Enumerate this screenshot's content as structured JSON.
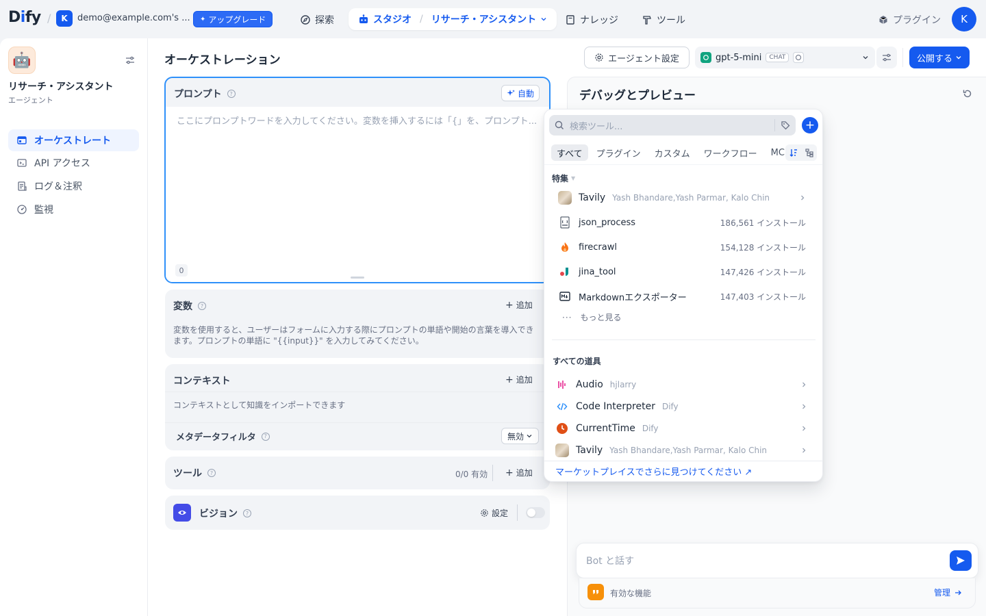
{
  "topbar": {
    "logo": "Dify",
    "workspace_initial": "K",
    "workspace_name": "demo@example.com's ...",
    "upgrade_label": "アップグレード",
    "nav": {
      "explore": "探索",
      "studio": "スタジオ",
      "app": "リサーチ・アシスタント",
      "knowledge": "ナレッジ",
      "tools": "ツール"
    },
    "plugins_label": "プラグイン",
    "user_initial": "K"
  },
  "sidebar": {
    "app_name": "リサーチ・アシスタント",
    "app_type": "エージェント",
    "items": [
      {
        "label": "オーケストレート",
        "icon": "layout-icon",
        "active": true
      },
      {
        "label": "API アクセス",
        "icon": "terminal-icon",
        "active": false
      },
      {
        "label": "ログ＆注釈",
        "icon": "file-list-icon",
        "active": false
      },
      {
        "label": "監視",
        "icon": "dashboard-gauge-icon",
        "active": false
      }
    ]
  },
  "header": {
    "title": "オーケストレーション",
    "agent_settings_label": "エージェント設定",
    "model_name": "gpt-5-mini",
    "model_badge": "CHAT",
    "publish_label": "公開する"
  },
  "prompt": {
    "title": "プロンプト",
    "auto_label": "自動",
    "placeholder": "ここにプロンプトワードを入力してください。変数を挿入するには「{」を、プロンプト...",
    "char_count": "0"
  },
  "variables": {
    "title": "変数",
    "add_label": "追加",
    "description": "変数を使用すると、ユーザーはフォームに入力する際にプロンプトの単語や開始の言葉を導入できます。プロンプトの単語に \"{{input}}\" を入力してみてください。"
  },
  "context": {
    "title": "コンテキスト",
    "add_label": "追加",
    "description": "コンテキストとして知識をインポートできます",
    "metadata_filter_label": "メタデータフィルタ",
    "metadata_filter_value": "無効"
  },
  "tools_section": {
    "title": "ツール",
    "status": "0/0 有効",
    "add_label": "追加"
  },
  "vision": {
    "title": "ビジョン",
    "settings_label": "設定",
    "enabled": false
  },
  "debug": {
    "title": "デバッグとプレビュー",
    "chat_placeholder": "Bot と話す",
    "features_label": "有効な機能",
    "manage_label": "管理"
  },
  "tool_picker": {
    "search_placeholder": "検索ツール...",
    "tabs": [
      "すべて",
      "プラグイン",
      "カスタム",
      "ワークフロー",
      "MCP"
    ],
    "active_tab": "すべて",
    "featured_title": "特集",
    "featured": [
      {
        "name": "Tavily",
        "meta": "Yash Bhandare,Yash Parmar, Kalo Chin",
        "installs": "",
        "icon": "tavily-logo-icon"
      },
      {
        "name": "json_process",
        "meta": "",
        "installs": "186,561 インストール",
        "icon": "json-file-icon"
      },
      {
        "name": "firecrawl",
        "meta": "",
        "installs": "154,128 インストール",
        "icon": "fire-icon"
      },
      {
        "name": "jina_tool",
        "meta": "",
        "installs": "147,426 インストール",
        "icon": "jina-logo-icon"
      },
      {
        "name": "Markdownエクスポーター",
        "meta": "",
        "installs": "147,403 インストール",
        "icon": "markdown-icon"
      }
    ],
    "more_label": "もっと見る",
    "all_title": "すべての道具",
    "all_tools": [
      {
        "name": "Audio",
        "author": "hjlarry",
        "icon": "audio-icon",
        "color": "#e6288f"
      },
      {
        "name": "Code Interpreter",
        "author": "Dify",
        "icon": "code-icon",
        "color": "#2e90fa"
      },
      {
        "name": "CurrentTime",
        "author": "Dify",
        "icon": "clock-icon",
        "color": "#e04f16"
      },
      {
        "name": "Tavily",
        "author": "Yash Bhandare,Yash Parmar, Kalo Chin",
        "icon": "tavily-logo-icon",
        "color": "#b8a98f"
      }
    ],
    "marketplace_link": "マーケットプレイスでさらに見つけてください ↗"
  },
  "colors": {
    "accent": "#155aef",
    "background": "#f2f4f7"
  }
}
